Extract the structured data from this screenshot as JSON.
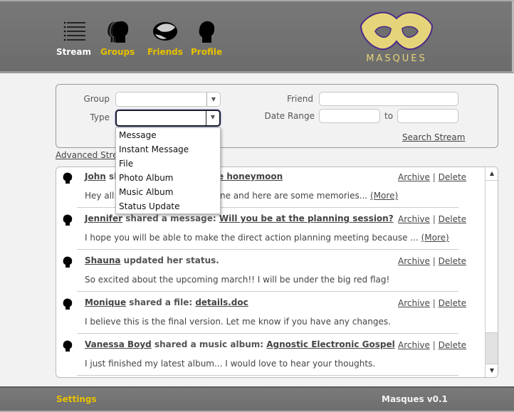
{
  "colors": {
    "accent": "#e8c000",
    "header_bg": "#727272",
    "active_nav": "#ffffff",
    "logo_gold": "#e6d47a",
    "logo_purple": "#4b2a8a"
  },
  "header": {
    "nav": [
      {
        "label": "Stream",
        "icon": "list-icon",
        "active": true
      },
      {
        "label": "Groups",
        "icon": "group-heads-icon",
        "active": false
      },
      {
        "label": "Friends",
        "icon": "handshake-icon",
        "active": false
      },
      {
        "label": "Profile",
        "icon": "head-icon",
        "active": false
      }
    ],
    "logo_text": "MASQUES"
  },
  "search": {
    "group_label": "Group",
    "group_value": "",
    "type_label": "Type",
    "type_value": "",
    "friend_label": "Friend",
    "friend_value": "",
    "date_range_label": "Date Range",
    "date_from": "",
    "to_label": "to",
    "date_to": "",
    "search_link": "Search Stream",
    "advanced_link": "Advanced Stream"
  },
  "type_dropdown": {
    "options": [
      "Message",
      "Instant Message",
      "File",
      "Photo Album",
      "Music Album",
      "Status Update"
    ]
  },
  "stream": {
    "archive_label": "Archive",
    "divider": "|",
    "delete_label": "Delete",
    "more_label": "(More)",
    "items": [
      {
        "user": "John",
        "action": " sh",
        "target": "e honeymoon",
        "body": "Hey all: ",
        "body_tail": "ne and here are some memories... ",
        "has_more": true
      },
      {
        "user": "Jennifer",
        "action": " shared a message: ",
        "target": "Will you be at the planning session?",
        "body": "I hope you will be able to make the direct action planning meeting because ... ",
        "has_more": true
      },
      {
        "user": "Shauna",
        "action": " updated her status.",
        "target": "",
        "body": "So excited about the upcoming march!! I will be under the big red flag!",
        "has_more": false
      },
      {
        "user": "Monique",
        "action": " shared a file: ",
        "target": "details.doc",
        "body": "I believe this is the final version. Let me know if you have any changes.",
        "has_more": false
      },
      {
        "user": "Vanessa Boyd",
        "action": " shared a music album: ",
        "target": "Agnostic Electronic Gospel",
        "body": "I just finished my latest album... I would love to hear your thoughts.",
        "has_more": false
      }
    ]
  },
  "footer": {
    "settings_label": "Settings",
    "version": "Masques v0.1"
  }
}
